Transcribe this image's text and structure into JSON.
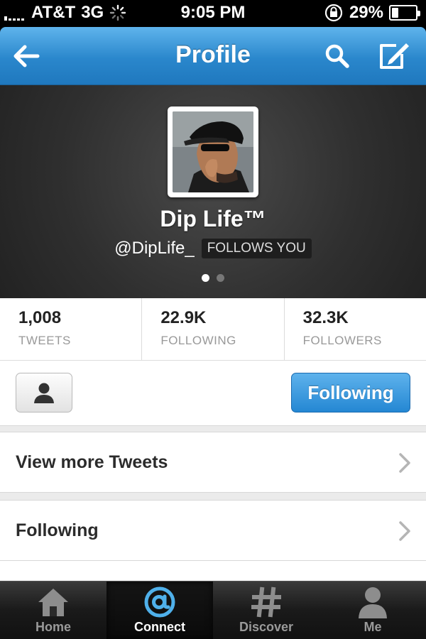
{
  "status_bar": {
    "carrier": "AT&T",
    "network": "3G",
    "time": "9:05 PM",
    "battery": "29%",
    "battery_level": 0.29
  },
  "navbar": {
    "title": "Profile",
    "back_icon": "arrow-left-icon",
    "search_icon": "search-icon",
    "compose_icon": "compose-icon"
  },
  "profile": {
    "name": "Dip Life™",
    "handle": "@DipLife_",
    "follows_badge": "FOLLOWS YOU",
    "page_count": 2,
    "active_page": 1
  },
  "stats": [
    {
      "value": "1,008",
      "label": "TWEETS"
    },
    {
      "value": "22.9K",
      "label": "FOLLOWING"
    },
    {
      "value": "32.3K",
      "label": "FOLLOWERS"
    }
  ],
  "actions": {
    "person_icon": "person-icon",
    "following_label": "Following"
  },
  "list": [
    {
      "label": "View more Tweets"
    },
    {
      "label": "Following"
    }
  ],
  "tabbar": {
    "tabs": [
      {
        "label": "Home",
        "icon": "home-icon",
        "active": false
      },
      {
        "label": "Connect",
        "icon": "at-icon",
        "active": true
      },
      {
        "label": "Discover",
        "icon": "hash-icon",
        "active": false
      },
      {
        "label": "Me",
        "icon": "person-icon",
        "active": false
      }
    ]
  },
  "colors": {
    "nav_blue": "#2a87cc",
    "button_blue": "#2487d3",
    "connect_active": "#4fb0ea"
  }
}
